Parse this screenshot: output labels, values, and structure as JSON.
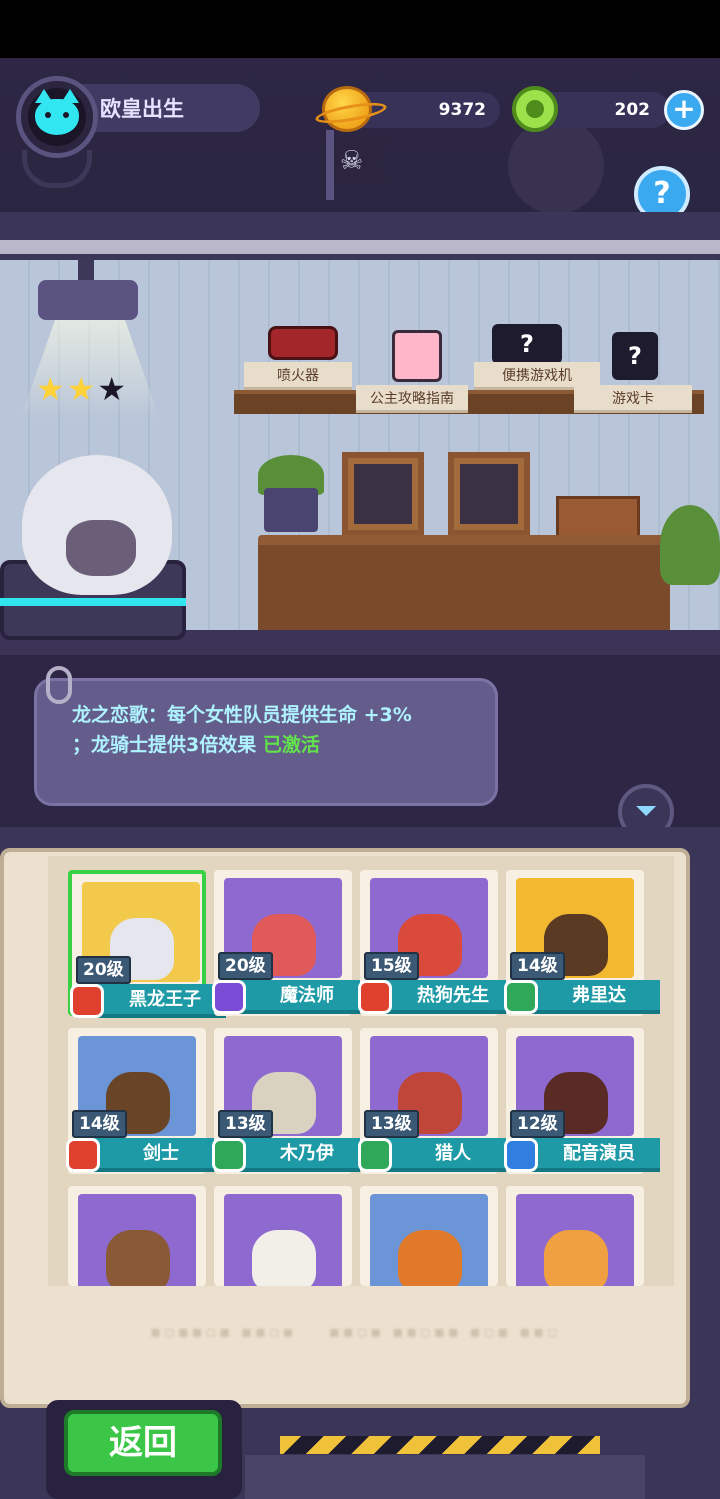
{
  "player": {
    "name": "欧皇出生"
  },
  "resources": {
    "coins": "9372",
    "gems": "202",
    "plus_label": "+"
  },
  "help_label": "?",
  "room": {
    "stars": {
      "filled": 2,
      "total": 3
    },
    "shelf_items": [
      {
        "label": "喷火器",
        "icon": "flamethrower-icon"
      },
      {
        "label": "公主攻略指南",
        "icon": "guide-book-icon"
      },
      {
        "label": "便携游戏机",
        "icon": "locked-console-icon"
      },
      {
        "label": "游戏卡",
        "icon": "locked-card-icon"
      }
    ],
    "locked_mark": "?"
  },
  "bonus": {
    "text": "龙之恋歌：每个女性队员提供生命 +3%\n；龙骑士提供3倍效果",
    "status": "已激活"
  },
  "heroes": [
    {
      "level": "20级",
      "name": "黑龙王子",
      "class": "red",
      "bg": "#f2c94a",
      "face": "#e6e6ee",
      "selected": true
    },
    {
      "level": "20级",
      "name": "魔法师",
      "class": "purple",
      "bg": "#8e6ad0",
      "face": "#e05a5a"
    },
    {
      "level": "15级",
      "name": "热狗先生",
      "class": "red",
      "bg": "#8e6ad0",
      "face": "#d94a3a"
    },
    {
      "level": "14级",
      "name": "弗里达",
      "class": "green",
      "bg": "#f2b830",
      "face": "#5a3a22"
    },
    {
      "level": "14级",
      "name": "剑士",
      "class": "red",
      "bg": "#6b95d6",
      "face": "#6a4426"
    },
    {
      "level": "13级",
      "name": "木乃伊",
      "class": "green",
      "bg": "#8e6ad0",
      "face": "#d9d2c0"
    },
    {
      "level": "13级",
      "name": "猎人",
      "class": "green",
      "bg": "#8e6ad0",
      "face": "#c0463a"
    },
    {
      "level": "12级",
      "name": "配音演员",
      "class": "blue",
      "bg": "#8e6ad0",
      "face": "#5a2a24"
    },
    {
      "level": "",
      "name": "",
      "class": "",
      "bg": "#8e6ad0",
      "face": "#8a5a36"
    },
    {
      "level": "",
      "name": "",
      "class": "",
      "bg": "#8e6ad0",
      "face": "#f2efe8"
    },
    {
      "level": "",
      "name": "",
      "class": "",
      "bg": "#6b95d6",
      "face": "#e07a2a"
    },
    {
      "level": "",
      "name": "",
      "class": "",
      "bg": "#8e6ad0",
      "face": "#f0a040"
    }
  ],
  "back_label": "返回",
  "colors": {
    "accent_green": "#63e34b",
    "selection": "#38d146",
    "name_bar": "#1e9aa6"
  }
}
